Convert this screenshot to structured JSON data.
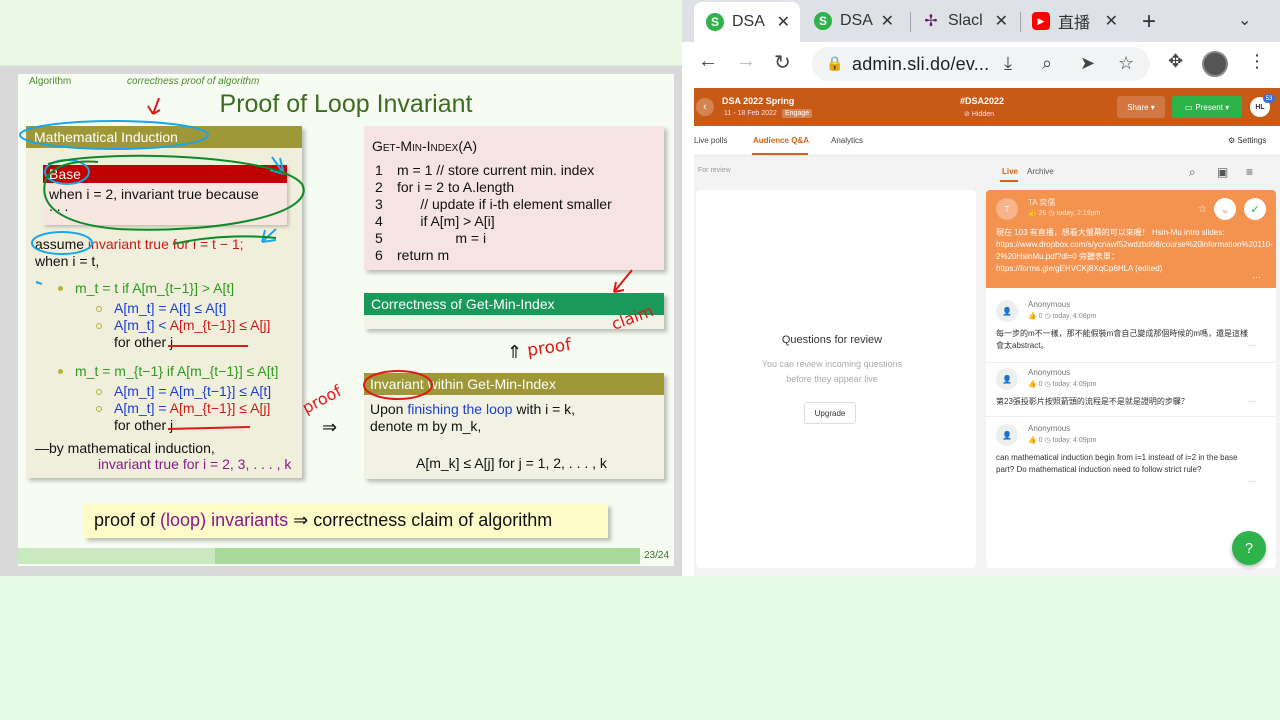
{
  "slide": {
    "header_left": "Algorithm",
    "header_mid": "correctness proof of algorithm",
    "title": "Proof of Loop Invariant",
    "mi_head": "Mathematical Induction",
    "base_head": "Base",
    "base_body": "when i = 2, invariant true because",
    "base_dots": ". . .",
    "assume_a": "assume ",
    "assume_b": "invariant true for i = t − 1;",
    "when_t": "when i = t,",
    "case1_head": "m_t = t if A[m_{t−1}] > A[t]",
    "case1_l1": "A[m_t] = A[t] ≤ A[t]",
    "case1_l2a": "A[m_t] < ",
    "case1_l2b": "A[m_{t−1}] ≤ A[j]",
    "case1_l3": "for other j",
    "case2_head": "m_t = m_{t−1} if A[m_{t−1}] ≤ A[t]",
    "case2_l1": "A[m_t] = A[m_{t−1}] ≤ A[t]",
    "case2_l2a": "A[m_t] = ",
    "case2_l2b": "A[m_{t−1}] ≤ A[j]",
    "case2_l3": "for other j",
    "by_mi": "—by mathematical induction,",
    "inv_true": "invariant true for i = 2, 3, . . . , k",
    "algo_title": "Get-Min-Index(A)",
    "algo_lines": [
      {
        "n": "1",
        "code": "m = 1 // store current min. index"
      },
      {
        "n": "2",
        "code": "for i = 2 to A.length"
      },
      {
        "n": "3",
        "code": "      // update if i-th element smaller"
      },
      {
        "n": "4",
        "code": "      if A[m] > A[i]"
      },
      {
        "n": "5",
        "code": "               m = i"
      },
      {
        "n": "6",
        "code": "return m"
      }
    ],
    "corr_head": "Correctness of Get-Min-Index",
    "arrow_up": "⇑",
    "implies": "⇒",
    "inv_head": "Invariant within Get-Min-Index",
    "inv_l1a": "Upon ",
    "inv_l1b": "finishing the loop",
    "inv_l1c": " with i = k,",
    "inv_l2": "denote m by m_k,",
    "inv_l3": "A[m_k] ≤ A[j] for j = 1, 2, . . . , k",
    "claim_a": "proof of ",
    "claim_b": "(loop) invariants",
    "claim_c": " ⇒ correctness claim of algorithm",
    "page": "23/24",
    "handwriting": [
      "proof",
      "proof",
      "claim"
    ]
  },
  "browser": {
    "tabs": [
      {
        "label": "DSA",
        "icon": "slido-icon",
        "color": "#2db34a"
      },
      {
        "label": "DSA",
        "icon": "slido-icon",
        "color": "#2db34a"
      },
      {
        "label": "Slacl",
        "icon": "slack-icon",
        "color": "#611f69"
      },
      {
        "label": "直播",
        "icon": "youtube-icon",
        "color": "#ff0000"
      }
    ],
    "url": "admin.sli.do/ev..."
  },
  "slido": {
    "event_title": "DSA 2022 Spring",
    "event_dates": "11 - 18 Feb 2022",
    "engage": "Engage",
    "hashtag": "#DSA2022",
    "hidden": "Hidden",
    "share": "Share ▾",
    "present": "Present ▾",
    "avatar": "HL",
    "badge": "53",
    "nav": [
      "Live polls",
      "Audience Q&A",
      "Analytics"
    ],
    "settings": "Settings",
    "for_review": "For review",
    "live": "Live",
    "archive": "Archive",
    "review_title": "Questions for review",
    "review_desc_1": "You can review incoming questions",
    "review_desc_2": "before they appear live",
    "upgrade": "Upgrade",
    "questions": [
      {
        "avatar": "T",
        "name": "TA 奕儒",
        "meta": "👍 26  ◷  today, 2:19pm",
        "text": "現在 103 有直播，想看大螢幕的可以來喔！ Hsin-Mu intro slides: https://www.dropbox.com/s/ycnawf52wdzbd68/course%20information%20110-2%20HsinMu.pdf?dl=0 旁聽表單： https://forms.gle/gEHVCKj8XqCp6HLA (edited)"
      },
      {
        "avatar": "👤",
        "name": "Anonymous",
        "meta": "👍 0  ◷  today, 4:08pm",
        "text": "每一步的m不一樣，那不能假裝m會自己變成那個時候的m嗎，還是這樣會太abstract。"
      },
      {
        "avatar": "👤",
        "name": "Anonymous",
        "meta": "👍 0  ◷  today, 4:09pm",
        "text": "第23張投影片按照箭頭的流程是不是就是證明的步驟？"
      },
      {
        "avatar": "👤",
        "name": "Anonymous",
        "meta": "👍 0  ◷  today, 4:09pm",
        "text": "can mathematical induction begin from i=1 instead of i=2 in the base part? Do mathematical induction need to follow strict rule?"
      }
    ]
  }
}
